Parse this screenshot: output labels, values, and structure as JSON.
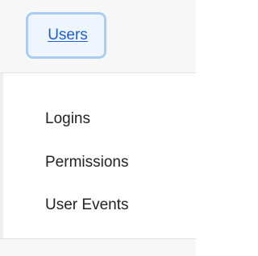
{
  "header": {
    "active_tab_label": "Users"
  },
  "menu": {
    "items": [
      {
        "label": "Logins"
      },
      {
        "label": "Permissions"
      },
      {
        "label": "User Events"
      }
    ]
  },
  "colors": {
    "link": "#1a5fd0",
    "focus_ring": "#a9cdf5",
    "text": "#222222",
    "header_background": "#f7f7f7"
  }
}
